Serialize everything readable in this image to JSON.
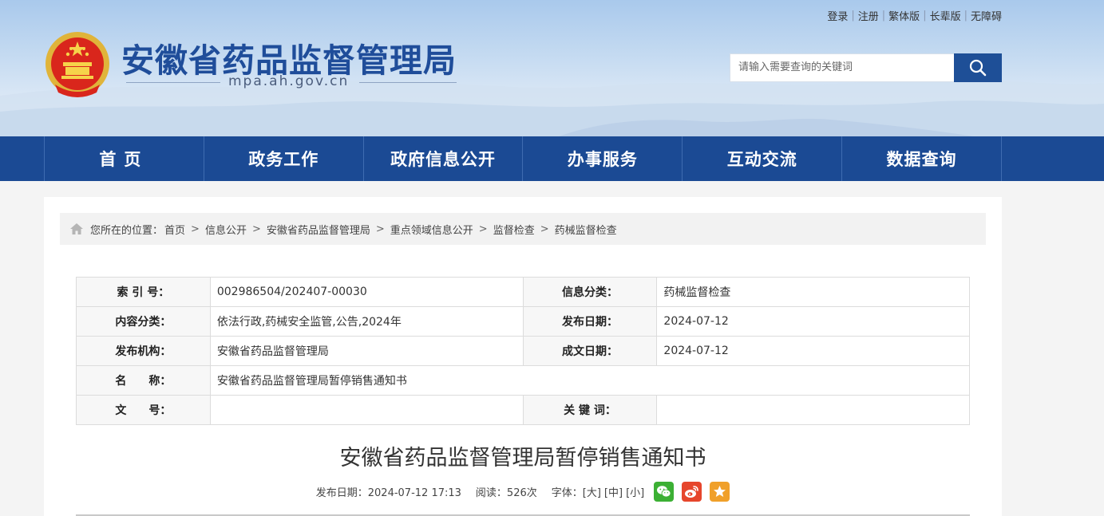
{
  "header": {
    "site_title": "安徽省药品监督管理局",
    "site_domain": "mpa.ah.gov.cn",
    "top_links": [
      "登录",
      "注册",
      "繁体版",
      "长辈版",
      "无障碍"
    ],
    "search_placeholder": "请输入需要查询的关键词",
    "emblem_icon": "national-emblem-icon",
    "search_icon": "magnifier-icon"
  },
  "nav": {
    "items": [
      "首页",
      "政务工作",
      "政府信息公开",
      "办事服务",
      "互动交流",
      "数据查询"
    ]
  },
  "breadcrumb": {
    "prefix": "您所在的位置：",
    "items": [
      "首页",
      "信息公开",
      "安徽省药品监督管理局",
      "重点领域信息公开",
      "监督检查",
      "药械监督检查"
    ]
  },
  "meta": {
    "index_no_label": "索 引 号：",
    "index_no": "002986504/202407-00030",
    "info_category_label": "信息分类：",
    "info_category": "药械监督检查",
    "content_category_label": "内容分类：",
    "content_category": "依法行政,药械安全监管,公告,2024年",
    "publish_date_label": "发布日期：",
    "publish_date": "2024-07-12",
    "publisher_label": "发布机构：",
    "publisher": "安徽省药品监督管理局",
    "created_date_label": "成文日期：",
    "created_date": "2024-07-12",
    "name_label": "名　　称：",
    "name": "安徽省药品监督管理局暂停销售通知书",
    "doc_no_label": "文　　号：",
    "doc_no": "",
    "keywords_label": "关 键 词：",
    "keywords": ""
  },
  "article": {
    "title": "安徽省药品监督管理局暂停销售通知书",
    "publish_label": "发布日期：2024-07-12 17:13",
    "reads_label": "阅读：526次",
    "font_label": "字体：",
    "font_large": "[大]",
    "font_medium": "[中]",
    "font_small": "[小]"
  },
  "colors": {
    "nav_bg": "#1b4a94",
    "title_blue": "#1f4d9a",
    "wechat": "#3cb034",
    "weibo": "#e6462c",
    "favorite": "#f0a02a"
  }
}
